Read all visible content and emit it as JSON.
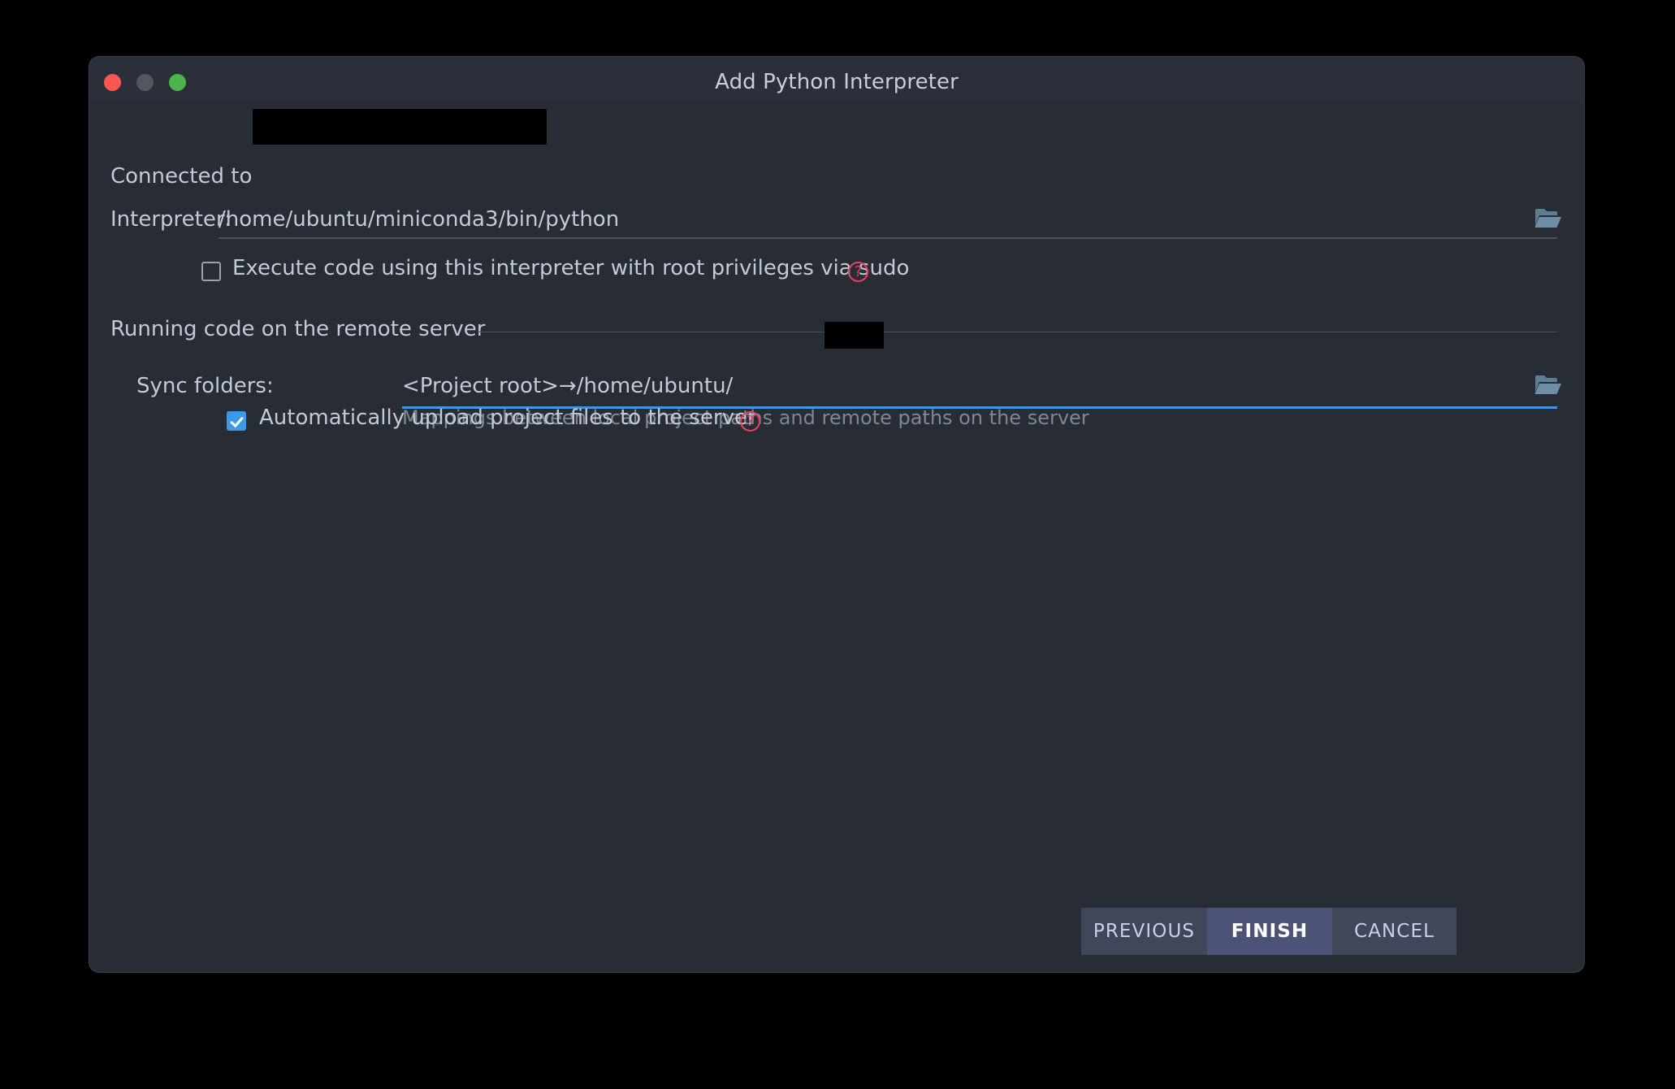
{
  "window": {
    "title": "Add Python Interpreter",
    "controls": {
      "close": "close",
      "minimize": "minimize",
      "maximize": "maximize"
    }
  },
  "colors": {
    "page_background": "#000000",
    "dialog_background": "#282c35",
    "titlebar_background": "#2b2f39",
    "text_primary": "#c4cad5",
    "text_dim": "#7f8794",
    "accent_focus": "#4394e5",
    "accent_checkbox": "#3d9ae8",
    "help_icon": "#e8415e",
    "button_background": "#414659",
    "button_primary_background": "#4d5277",
    "traffic_close": "#fc5753",
    "traffic_minimize": "#54575f",
    "traffic_maximize": "#4cb44c",
    "folder_icon": "#5f7d92",
    "rule": "#464c59",
    "redaction": "#000000"
  },
  "form": {
    "connected": {
      "label": "Connected to",
      "value": ""
    },
    "interpreter": {
      "label": "Interpreter:",
      "value": "/home/ubuntu/miniconda3/bin/python",
      "browse_icon": "folder-icon"
    },
    "sudo": {
      "label": "Execute code using this interpreter with root privileges via sudo",
      "checked": false,
      "help_glyph": "?",
      "help_icon": "help-circle-icon"
    }
  },
  "remote_section": {
    "header": "Running code on the remote server",
    "sync_folders": {
      "label": "Sync folders:",
      "value": "<Project root>→/home/ubuntu/",
      "hint": "Mappings between local project paths and remote paths on the server",
      "browse_icon": "folder-icon",
      "focused": true
    },
    "auto_upload": {
      "label": "Automatically upload project files to the server",
      "checked": true,
      "help_glyph": "?",
      "help_icon": "help-circle-icon"
    }
  },
  "footer": {
    "previous_label": "PREVIOUS",
    "finish_label": "FINISH",
    "cancel_label": "CANCEL"
  }
}
